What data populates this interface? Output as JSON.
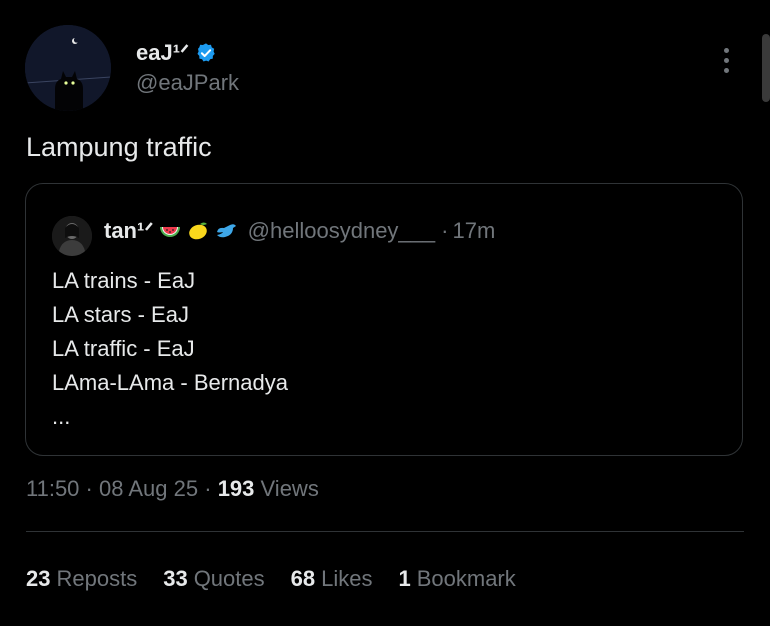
{
  "author": {
    "display_name": "eaJ¹ᐟ",
    "handle": "@eaJPark",
    "verified": true,
    "verified_color": "#1d9bf0"
  },
  "tweet": {
    "text": "Lampung traffic"
  },
  "quote": {
    "display_name": "tan¹ᐟ",
    "emojis": [
      "watermelon-icon",
      "lemon-icon",
      "bird-icon"
    ],
    "handle": "@helloosydney___",
    "separator": "·",
    "time": "17m",
    "lines": [
      "LA trains - EaJ",
      "LA stars - EaJ",
      "LA traffic - EaJ",
      "LAma-LAma - Bernadya",
      "..."
    ]
  },
  "meta": {
    "time": "11:50",
    "sep1": "·",
    "date": "08 Aug 25",
    "sep2": "·",
    "views_count": "193",
    "views_label": "Views"
  },
  "stats": {
    "reposts_count": "23",
    "reposts_label": "Reposts",
    "quotes_count": "33",
    "quotes_label": "Quotes",
    "likes_count": "68",
    "likes_label": "Likes",
    "bookmarks_count": "1",
    "bookmarks_label": "Bookmark"
  },
  "colors": {
    "background": "#000000",
    "text_primary": "#e7e9ea",
    "text_secondary": "#71767b",
    "border": "#2f3336"
  }
}
